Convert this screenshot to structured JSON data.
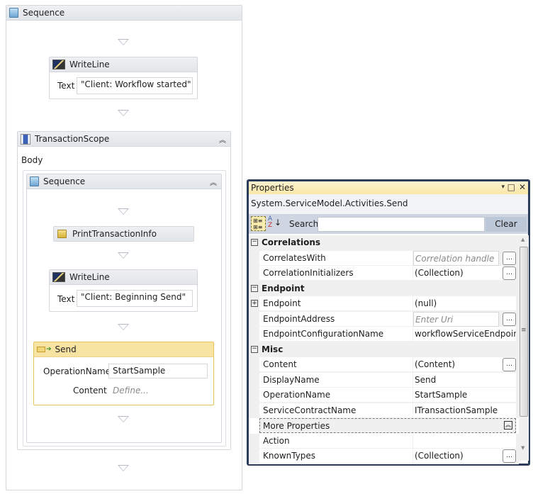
{
  "designer": {
    "outer_sequence": {
      "title": "Sequence",
      "icon": "sequence-icon"
    },
    "writeline1": {
      "title": "WriteLine",
      "text_label": "Text",
      "text_value": "\"Client: Workflow started\""
    },
    "transaction_scope": {
      "title": "TransactionScope",
      "body_label": "Body"
    },
    "inner_sequence": {
      "title": "Sequence"
    },
    "print_info": {
      "title": "PrintTransactionInfo"
    },
    "writeline2": {
      "title": "WriteLine",
      "text_label": "Text",
      "text_value": "\"Client: Beginning Send\""
    },
    "send": {
      "title": "Send",
      "operation_label": "OperationName",
      "operation_value": "StartSample",
      "content_label": "Content",
      "content_placeholder": "Define..."
    },
    "colors": {
      "send_header": "#f8e4a2",
      "send_border": "#e8c35b"
    }
  },
  "properties": {
    "title": "Properties",
    "controls": {
      "dropdown": "▾",
      "maximize": "□",
      "close": "✕"
    },
    "type_name": "System.ServiceModel.Activities.Send",
    "search_label": "Search:",
    "search_value": "",
    "clear_label": "Clear",
    "categories": [
      {
        "name": "Correlations",
        "toggle": "−",
        "rows": [
          {
            "name": "CorrelatesWith",
            "value": "Correlation handle",
            "placeholder": true,
            "ellipsis": true
          },
          {
            "name": "CorrelationInitializers",
            "value": "(Collection)",
            "ellipsis": true
          }
        ]
      },
      {
        "name": "Endpoint",
        "toggle": "−",
        "rows": [
          {
            "name": "Endpoint",
            "value": "(null)",
            "expander": "+"
          },
          {
            "name": "EndpointAddress",
            "value": "Enter Uri",
            "placeholder": true,
            "ellipsis": true
          },
          {
            "name": "EndpointConfigurationName",
            "value": "workflowServiceEndpoint"
          }
        ]
      },
      {
        "name": "Misc",
        "toggle": "−",
        "rows": [
          {
            "name": "Content",
            "value": "(Content)",
            "ellipsis": true
          },
          {
            "name": "DisplayName",
            "value": "Send"
          },
          {
            "name": "OperationName",
            "value": "StartSample"
          },
          {
            "name": "ServiceContractName",
            "value": "ITransactionSample"
          }
        ]
      }
    ],
    "more_properties": "More Properties",
    "more_rows": [
      {
        "name": "Action",
        "value": ""
      },
      {
        "name": "KnownTypes",
        "value": "(Collection)",
        "ellipsis": true
      }
    ]
  }
}
